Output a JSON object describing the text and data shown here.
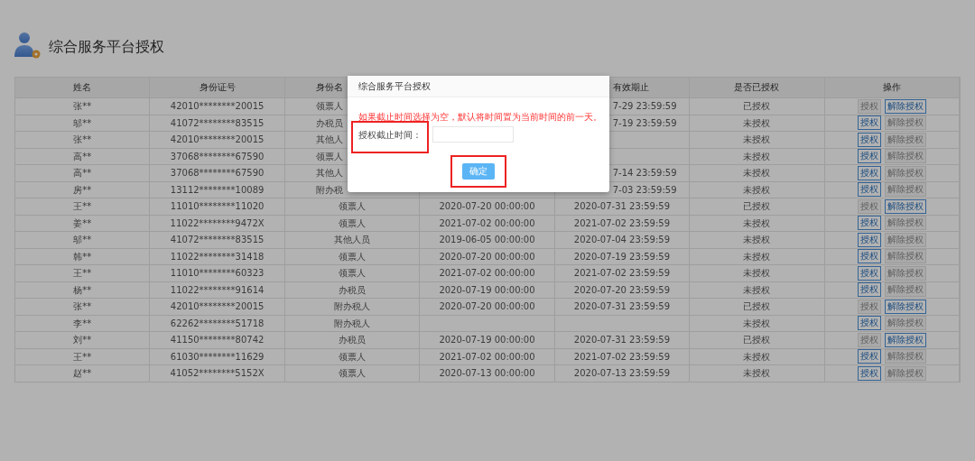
{
  "page": {
    "title": "综合服务平台授权"
  },
  "table": {
    "columns": [
      {
        "label": "姓名"
      },
      {
        "label": "身份证号"
      },
      {
        "label": "身份名"
      },
      {},
      {
        "label": "有效期止"
      },
      {
        "label": "是否已授权"
      },
      {
        "label": "操作"
      }
    ],
    "rows": [
      {
        "name": "张**",
        "id": "42010********20015",
        "role": "领票人",
        "end": "7-29 23:59:59",
        "status": "已授权",
        "actions": [
          {
            "label": "授权",
            "disabled": true
          },
          {
            "label": "解除授权",
            "disabled": false
          }
        ]
      },
      {
        "name": "邬**",
        "id": "41072********83515",
        "role": "办税员",
        "end": "7-19 23:59:59",
        "status": "未授权",
        "actions": [
          {
            "label": "授权",
            "disabled": false
          },
          {
            "label": "解除授权",
            "disabled": true
          }
        ]
      },
      {
        "name": "张**",
        "id": "42010********20015",
        "role": "其他人",
        "status": "未授权",
        "actions": [
          {
            "label": "授权",
            "disabled": false
          },
          {
            "label": "解除授权",
            "disabled": true
          }
        ]
      },
      {
        "name": "高**",
        "id": "37068********67590",
        "role": "领票人",
        "status": "未授权",
        "actions": [
          {
            "label": "授权",
            "disabled": false
          },
          {
            "label": "解除授权",
            "disabled": true
          }
        ]
      },
      {
        "name": "高**",
        "id": "37068********67590",
        "role": "其他人",
        "end": "7-14 23:59:59",
        "status": "未授权",
        "actions": [
          {
            "label": "授权",
            "disabled": false
          },
          {
            "label": "解除授权",
            "disabled": true
          }
        ]
      },
      {
        "name": "房**",
        "id": "13112********10089",
        "role": "附办税",
        "end": "7-03 23:59:59",
        "status": "未授权",
        "actions": [
          {
            "label": "授权",
            "disabled": false
          },
          {
            "label": "解除授权",
            "disabled": true
          }
        ]
      },
      {
        "name": "王**",
        "id": "11010********11020",
        "role": "领票人",
        "start": "2020-07-20 00:00:00",
        "end": "2020-07-31 23:59:59",
        "status": "已授权",
        "actions": [
          {
            "label": "授权",
            "disabled": true
          },
          {
            "label": "解除授权",
            "disabled": false
          }
        ]
      },
      {
        "name": "姜**",
        "id": "11022********9472X",
        "role": "领票人",
        "start": "2021-07-02 00:00:00",
        "end": "2021-07-02 23:59:59",
        "status": "未授权",
        "actions": [
          {
            "label": "授权",
            "disabled": false
          },
          {
            "label": "解除授权",
            "disabled": true
          }
        ]
      },
      {
        "name": "邬**",
        "id": "41072********83515",
        "role": "其他人员",
        "start": "2019-06-05 00:00:00",
        "end": "2020-07-04 23:59:59",
        "status": "未授权",
        "actions": [
          {
            "label": "授权",
            "disabled": false
          },
          {
            "label": "解除授权",
            "disabled": true
          }
        ]
      },
      {
        "name": "韩**",
        "id": "11022********31418",
        "role": "领票人",
        "start": "2020-07-20 00:00:00",
        "end": "2020-07-19 23:59:59",
        "status": "未授权",
        "actions": [
          {
            "label": "授权",
            "disabled": false
          },
          {
            "label": "解除授权",
            "disabled": true
          }
        ]
      },
      {
        "name": "王**",
        "id": "11010********60323",
        "role": "领票人",
        "start": "2021-07-02 00:00:00",
        "end": "2021-07-02 23:59:59",
        "status": "未授权",
        "actions": [
          {
            "label": "授权",
            "disabled": false
          },
          {
            "label": "解除授权",
            "disabled": true
          }
        ]
      },
      {
        "name": "杨**",
        "id": "11022********91614",
        "role": "办税员",
        "start": "2020-07-19 00:00:00",
        "end": "2020-07-20 23:59:59",
        "status": "未授权",
        "actions": [
          {
            "label": "授权",
            "disabled": false
          },
          {
            "label": "解除授权",
            "disabled": true
          }
        ]
      },
      {
        "name": "张**",
        "id": "42010********20015",
        "role": "附办税人",
        "start": "2020-07-20 00:00:00",
        "end": "2020-07-31 23:59:59",
        "status": "已授权",
        "actions": [
          {
            "label": "授权",
            "disabled": true
          },
          {
            "label": "解除授权",
            "disabled": false
          }
        ]
      },
      {
        "name": "李**",
        "id": "62262********51718",
        "role": "附办税人",
        "status": "未授权",
        "actions": [
          {
            "label": "授权",
            "disabled": false
          },
          {
            "label": "解除授权",
            "disabled": true
          }
        ]
      },
      {
        "name": "刘**",
        "id": "41150********80742",
        "role": "办税员",
        "start": "2020-07-19 00:00:00",
        "end": "2020-07-31 23:59:59",
        "status": "已授权",
        "actions": [
          {
            "label": "授权",
            "disabled": true
          },
          {
            "label": "解除授权",
            "disabled": false
          }
        ]
      },
      {
        "name": "王**",
        "id": "61030********11629",
        "role": "领票人",
        "start": "2021-07-02 00:00:00",
        "end": "2021-07-02 23:59:59",
        "status": "未授权",
        "actions": [
          {
            "label": "授权",
            "disabled": false
          },
          {
            "label": "解除授权",
            "disabled": true
          }
        ]
      },
      {
        "name": "赵**",
        "id": "41052********5152X",
        "role": "领票人",
        "start": "2020-07-13 00:00:00",
        "end": "2020-07-13 23:59:59",
        "status": "未授权",
        "actions": [
          {
            "label": "授权",
            "disabled": false
          },
          {
            "label": "解除授权",
            "disabled": true
          }
        ]
      }
    ]
  },
  "dialog": {
    "title": "综合服务平台授权",
    "warning": "如果截止时间选择为空，默认将时间置为当前时间的前一天。",
    "label": "授权截止时间：",
    "confirm": "确定"
  }
}
